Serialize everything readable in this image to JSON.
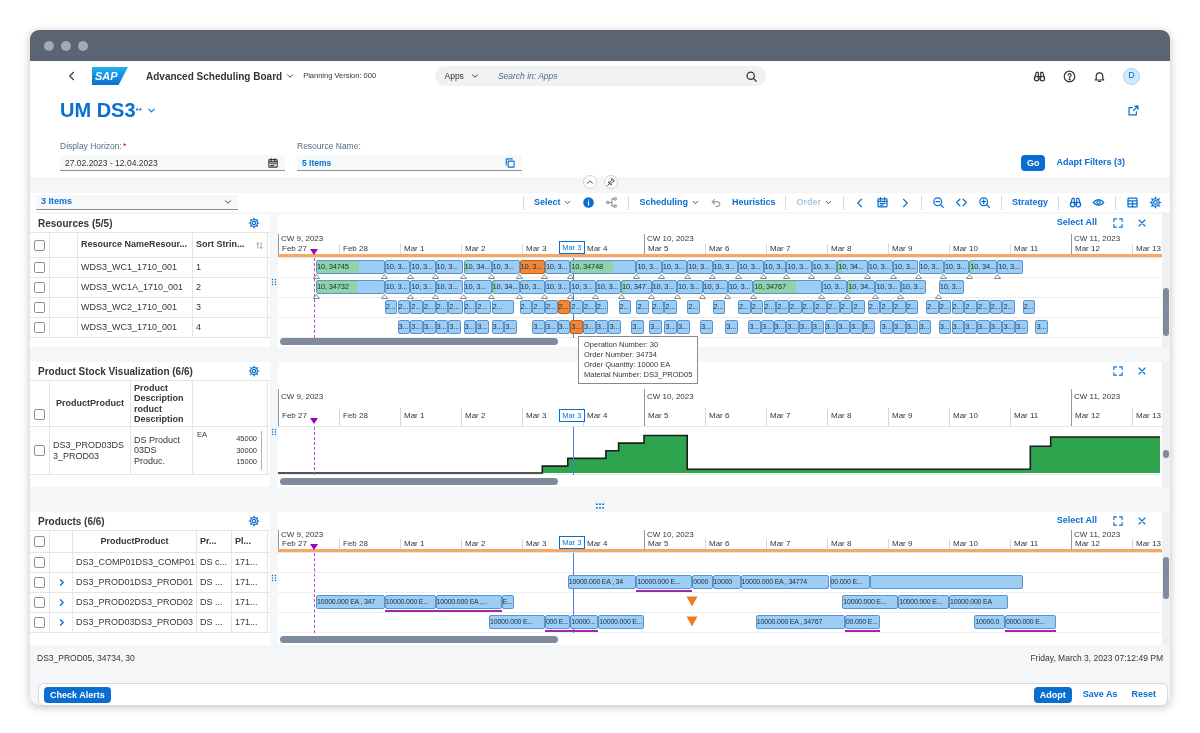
{
  "shell": {
    "logo": "SAP",
    "app_title": "Advanced Scheduling Board",
    "planning_version": "Planning Version: 000",
    "search_scope": "Apps",
    "search_placeholder": "Search in: Apps",
    "avatar": "D"
  },
  "variant": {
    "title": "UM DS3$^{**}$"
  },
  "filters": [
    {
      "label": "Display Horizon:",
      "required_mark": "*",
      "value": "27.02.2023 - 12.04.2023",
      "kind": "date"
    },
    {
      "label": "Resource Name:",
      "value": "5 Items",
      "kind": "multi"
    }
  ],
  "filter_actions": [
    {
      "label": "Go",
      "kind": "primary"
    },
    {
      "label": "Adapt Filters (3)",
      "kind": "link"
    }
  ],
  "toolbar": {
    "view_select": "3 Items",
    "select": "Select",
    "scheduling": "Scheduling",
    "heuristics": "Heuristics",
    "order": {
      "label": "Order",
      "disabled": true
    },
    "strategy": "Strategy"
  },
  "resources": {
    "title": "Resources (5/5)",
    "select_all": "Select All",
    "header_checked": false,
    "columns": [
      "Resource NameResour...",
      "Sort Strin..."
    ],
    "timeline": {
      "weeks": [
        "CW 9, 2023",
        "CW 10, 2023",
        "CW 11, 2023"
      ],
      "days": [
        "Feb 27",
        "Feb 28",
        "Mar 1",
        "Mar 2",
        "Mar 3",
        "Mar 4",
        "Mar 5",
        "Mar 6",
        "Mar 7",
        "Mar 8",
        "Mar 9",
        "Mar 10",
        "Mar 11",
        "Mar 12",
        "Mar 13"
      ],
      "cursor_label": "Mar 3"
    },
    "rows": [
      {
        "checked": false,
        "cells": [
          "WDS3_WC1_1710_001",
          "1"
        ],
        "milestones": true,
        "bars": [
          {
            "label": "10, 34745",
            "level": 0.63,
            "selected": false
          },
          {
            "label": "10, 3...",
            "selected": false
          },
          {
            "label": "10, 3...",
            "selected": false
          },
          {
            "label": "10, 3...",
            "selected": false
          },
          {
            "label": "10, 34...",
            "level": 0.15,
            "selected": false
          },
          {
            "label": "10, 3...",
            "selected": false
          },
          {
            "label": "10, 3...",
            "selected": true
          },
          {
            "label": "10, 3...",
            "selected": false
          },
          {
            "label": "10, 34748",
            "level": 0.65,
            "selected": false
          },
          {
            "label": "10, 3...",
            "selected": false
          },
          {
            "label": "10, 3...",
            "selected": false
          },
          {
            "label": "10, 3...",
            "selected": false
          },
          {
            "label": "10, 3...",
            "selected": false
          },
          {
            "label": "10, 3...",
            "selected": false
          },
          {
            "label": "10, 3...",
            "selected": false
          },
          {
            "label": "10, 3...",
            "selected": false
          },
          {
            "label": "10, 3...",
            "selected": false
          },
          {
            "label": "10, 34...",
            "level": 0.15,
            "selected": false
          },
          {
            "label": "10, 3...",
            "selected": false
          },
          {
            "label": "10, 3...",
            "selected": false
          },
          {
            "label": "10, 3...",
            "selected": false
          },
          {
            "label": "10, 3...",
            "selected": false
          },
          {
            "label": "10, 34...",
            "level": 0.15,
            "selected": false
          },
          {
            "label": "10, 3...",
            "selected": false
          }
        ]
      },
      {
        "checked": false,
        "cells": [
          "WDS3_WC1A_1710_001",
          "2"
        ],
        "milestones": true,
        "bars": [
          {
            "label": "10, 34732",
            "level": 0.6,
            "selected": false
          },
          {
            "label": "10, 3...",
            "selected": false
          },
          {
            "label": "10, 3...",
            "selected": false
          },
          {
            "label": "10, 3...",
            "selected": false
          },
          {
            "label": "10, 3...",
            "selected": false
          },
          {
            "label": "10, 34...",
            "level": 0.15,
            "selected": false
          },
          {
            "label": "10, 3...",
            "selected": false
          },
          {
            "label": "10, 3...",
            "selected": false
          },
          {
            "label": "10, 3...",
            "selected": false
          },
          {
            "label": "10, 3...",
            "selected": false
          },
          {
            "label": "10, 347...",
            "level": 0.15,
            "selected": false
          },
          {
            "label": "10, 3...",
            "selected": false
          },
          {
            "label": "10, 3...",
            "selected": false
          },
          {
            "label": "10, 3...",
            "selected": false
          },
          {
            "label": "10, 3...",
            "selected": false
          },
          {
            "label": "10, 34767",
            "level": 0.63,
            "selected": false
          },
          {
            "label": "10, 3...",
            "selected": false
          },
          {
            "label": "10, 34...",
            "level": 0.15,
            "selected": false
          },
          {
            "label": "10, 3...",
            "selected": false
          },
          {
            "label": "10, 3...",
            "selected": false
          },
          {
            "label": "10, 3...",
            "selected": false
          }
        ]
      },
      {
        "checked": false,
        "cells": [
          "WDS3_WC2_1710_001",
          "3"
        ],
        "milestones": false,
        "bars": [
          {
            "label": "2...",
            "selected": false
          },
          {
            "label": "2...",
            "selected": false
          },
          {
            "label": "2...",
            "selected": false
          },
          {
            "label": "2...",
            "selected": false
          },
          {
            "label": "2...",
            "selected": false
          },
          {
            "label": "2...",
            "selected": false
          },
          {
            "label": "2...",
            "selected": false
          },
          {
            "label": "2...",
            "selected": false
          },
          {
            "label": "2...",
            "selected": false
          },
          {
            "label": "2...",
            "selected": false
          },
          {
            "label": "2...",
            "selected": false
          },
          {
            "label": "2...",
            "selected": false
          },
          {
            "label": "2...",
            "selected": true
          },
          {
            "label": "2...",
            "selected": false
          },
          {
            "label": "2...",
            "selected": false
          },
          {
            "label": "2...",
            "selected": false
          },
          {
            "label": "2...",
            "selected": false
          },
          {
            "label": "2...",
            "selected": false
          },
          {
            "label": "2...",
            "selected": false
          },
          {
            "label": "2...",
            "selected": false
          },
          {
            "label": "2...",
            "selected": false
          },
          {
            "label": "2...",
            "selected": false
          },
          {
            "label": "2...",
            "selected": false
          },
          {
            "label": "2...",
            "selected": false
          },
          {
            "label": "2...",
            "selected": false
          },
          {
            "label": "2...",
            "selected": false
          },
          {
            "label": "2...",
            "selected": false
          },
          {
            "label": "2...",
            "selected": false
          },
          {
            "label": "2...",
            "selected": false
          },
          {
            "label": "2...",
            "selected": false
          },
          {
            "label": "2...",
            "selected": false
          },
          {
            "label": "2...",
            "selected": false
          },
          {
            "label": "2...",
            "selected": false
          },
          {
            "label": "2...",
            "selected": false
          },
          {
            "label": "2...",
            "selected": false
          },
          {
            "label": "2...",
            "selected": false
          },
          {
            "label": "2...",
            "selected": false
          },
          {
            "label": "2...",
            "selected": false
          },
          {
            "label": "2...",
            "selected": false
          },
          {
            "label": "2...",
            "selected": false
          },
          {
            "label": "2...",
            "selected": false
          },
          {
            "label": "2...",
            "selected": false
          },
          {
            "label": "2...",
            "selected": false
          },
          {
            "label": "2...",
            "selected": false
          }
        ]
      },
      {
        "checked": false,
        "cells": [
          "WDS3_WC3_1710_001",
          "4"
        ],
        "milestones": false,
        "bars": [
          {
            "label": "3...",
            "selected": false
          },
          {
            "label": "3...",
            "selected": false
          },
          {
            "label": "3...",
            "selected": false
          },
          {
            "label": "3...",
            "selected": false
          },
          {
            "label": "3...",
            "selected": false
          },
          {
            "label": "3...",
            "selected": false
          },
          {
            "label": "3...",
            "selected": false
          },
          {
            "label": "3...",
            "selected": false
          },
          {
            "label": "3...",
            "selected": false
          },
          {
            "label": "3...",
            "selected": false
          },
          {
            "label": "3...",
            "selected": false
          },
          {
            "label": "3...",
            "selected": false
          },
          {
            "label": "3...",
            "selected": true
          },
          {
            "label": "3...",
            "selected": false
          },
          {
            "label": "3...",
            "selected": false
          },
          {
            "label": "3...",
            "selected": false
          },
          {
            "label": "3...",
            "selected": false
          },
          {
            "label": "3...",
            "selected": false
          },
          {
            "label": "3...",
            "selected": false
          },
          {
            "label": "3...",
            "selected": false
          },
          {
            "label": "3...",
            "selected": false
          },
          {
            "label": "3...",
            "selected": false
          },
          {
            "label": "3...",
            "selected": false
          },
          {
            "label": "3...",
            "selected": false
          },
          {
            "label": "3...",
            "selected": false
          },
          {
            "label": "3...",
            "selected": false
          },
          {
            "label": "3...",
            "selected": false
          },
          {
            "label": "3...",
            "selected": false
          },
          {
            "label": "3...",
            "selected": false
          },
          {
            "label": "3...",
            "selected": false
          },
          {
            "label": "3...",
            "selected": false
          },
          {
            "label": "3...",
            "selected": false
          },
          {
            "label": "3...",
            "selected": false
          },
          {
            "label": "3...",
            "selected": false
          },
          {
            "label": "3...",
            "selected": false
          },
          {
            "label": "3...",
            "selected": false
          },
          {
            "label": "3...",
            "selected": false
          },
          {
            "label": "3...",
            "selected": false
          },
          {
            "label": "3...",
            "selected": false
          },
          {
            "label": "3...",
            "selected": false
          },
          {
            "label": "3...",
            "selected": false
          },
          {
            "label": "3...",
            "selected": false
          },
          {
            "label": "3...",
            "selected": false
          },
          {
            "label": "3...",
            "selected": false
          }
        ]
      }
    ]
  },
  "tooltip": {
    "lines": [
      "Operation Number: 30",
      "Order Number: 34734",
      "Order Quantity: 10000 EA",
      "Material Number: DS3_PROD05"
    ]
  },
  "stock": {
    "title": "Product Stock Visualization (6/6)",
    "header_checked": false,
    "columns": [
      "ProductProduct",
      "Product Description roduct Description"
    ],
    "timeline": {
      "weeks": [
        "CW 9, 2023",
        "CW 10, 2023",
        "CW 11, 2023"
      ],
      "days": [
        "Feb 27",
        "Feb 28",
        "Mar 1",
        "Mar 2",
        "Mar 3",
        "Mar 4",
        "Mar 5",
        "Mar 6",
        "Mar 7",
        "Mar 8",
        "Mar 9",
        "Mar 10",
        "Mar 11",
        "Mar 12",
        "Mar 13"
      ],
      "cursor_label": "Mar 3"
    },
    "rows": [
      {
        "checked": false,
        "cells": [
          "DS3_PROD03DS3_PROD03",
          "DS Product 03DS Produc."
        ],
        "axis": {
          "unit": "EA",
          "labels": [
            "45000",
            "30000",
            "15000"
          ]
        }
      }
    ]
  },
  "products": {
    "title": "Products (6/6)",
    "select_all": "Select All",
    "header_checked": false,
    "columns": [
      "ProductProduct",
      "Pr...",
      "Pl..."
    ],
    "timeline": {
      "weeks": [
        "CW 9, 2023",
        "CW 10, 2023",
        "CW 11, 2023"
      ],
      "days": [
        "Feb 27",
        "Feb 28",
        "Mar 1",
        "Mar 2",
        "Mar 3",
        "Mar 4",
        "Mar 5",
        "Mar 6",
        "Mar 7",
        "Mar 8",
        "Mar 9",
        "Mar 10",
        "Mar 11",
        "Mar 12",
        "Mar 13"
      ],
      "cursor_label": "Mar 3"
    },
    "rows": [
      {
        "checked": false,
        "has_children": false,
        "alert": false,
        "cells": [
          "DS3_COMP01DS3_COMP01",
          "DS c...",
          "171..."
        ]
      },
      {
        "checked": false,
        "has_children": true,
        "alert": false,
        "cells": [
          "DS3_PROD01DS3_PROD01",
          "DS ...",
          "171..."
        ],
        "bars": [
          {
            "label": "10000.000 EA , 34",
            "underlined": false
          },
          {
            "label": "10000.000 E...",
            "underlined": true
          },
          {
            "label": "0000",
            "underlined": false
          },
          {
            "label": "10000",
            "underlined": false
          },
          {
            "label": "10000.000 EA , 34774",
            "underlined": false
          },
          {
            "label": "00.000 E...",
            "underlined": false
          },
          {
            "underlined": false
          }
        ]
      },
      {
        "checked": false,
        "has_children": true,
        "alert": true,
        "cells": [
          "DS3_PROD02DS3_PROD02",
          "DS ...",
          "171..."
        ],
        "bars": [
          {
            "label": "10000.000 EA , 347",
            "underlined": false
          },
          {
            "label": "10000.000 E...",
            "underlined": true
          },
          {
            "label": "10000.000 EA ,...",
            "underlined": true
          },
          {
            "label": "E...",
            "underlined": false
          },
          {
            "label": "10000.000 E...",
            "underlined": false
          },
          {
            "label": "10000.000 E...",
            "underlined": false
          },
          {
            "label": "10000.000 EA",
            "underlined": false
          }
        ]
      },
      {
        "checked": false,
        "has_children": true,
        "alert": true,
        "cells": [
          "DS3_PROD03DS3_PROD03",
          "DS ...",
          "171..."
        ],
        "bars": [
          {
            "label": "10000.000 E...",
            "underlined": false
          },
          {
            "label": "000 E...",
            "underlined": true
          },
          {
            "label": "10000...",
            "underlined": true
          },
          {
            "label": "10000.000 E...",
            "underlined": false
          },
          {
            "label": "10000.000 EA , 34767",
            "underlined": false
          },
          {
            "label": "00.000 E...",
            "underlined": true
          },
          {
            "label": "10000.0",
            "underlined": false
          },
          {
            "label": "0000.000 E...",
            "underlined": true
          }
        ]
      }
    ]
  },
  "status": {
    "left": "DS3_PROD05, 34734, 30",
    "right": "Friday, March 3, 2023 07:12:49 PM"
  },
  "footer": {
    "left": [
      {
        "label": "Check Alerts",
        "kind": "primary"
      }
    ],
    "right": [
      {
        "label": "Adopt",
        "kind": "primary"
      },
      {
        "label": "Save As",
        "kind": "link"
      },
      {
        "label": "Reset",
        "kind": "link"
      }
    ]
  }
}
